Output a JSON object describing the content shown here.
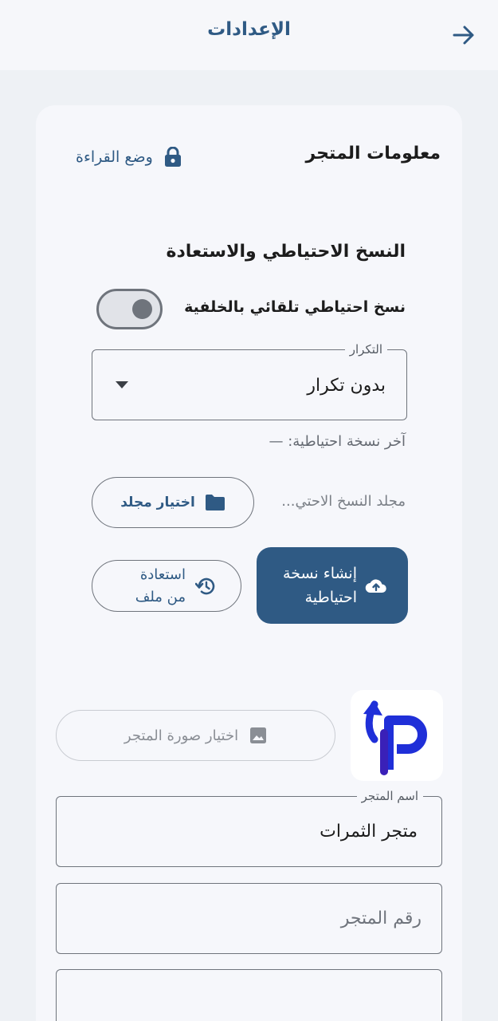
{
  "header": {
    "title": "الإعدادات",
    "back_icon": "arrow-right-icon"
  },
  "store_info": {
    "title": "معلومات المتجر",
    "read_mode_label": "وضع القراءة",
    "read_mode_icon": "lock-icon"
  },
  "backup": {
    "title": "النسخ الاحتياطي والاستعادة",
    "auto_backup_label": "نسخ احتياطي تلقائي بالخلفية",
    "auto_backup_enabled": false,
    "frequency_label": "التكرار",
    "frequency_value": "بدون تكرار",
    "last_backup": "آخر نسخة احتياطية: —",
    "folder_label": "مجلد النسخ الاحتي...",
    "choose_folder_button": "اختيار مجلد",
    "create_backup_button": "إنشاء نسخة احتياطية",
    "restore_button": "استعادة من ملف"
  },
  "store_form": {
    "choose_image_button": "اختيار صورة المتجر",
    "store_name_label": "اسم المتجر",
    "store_name_value": "متجر الثمرات",
    "store_number_placeholder": "رقم المتجر"
  },
  "colors": {
    "accent": "#2f5a84",
    "background": "#eef1f5",
    "card": "#f6f7fb"
  }
}
